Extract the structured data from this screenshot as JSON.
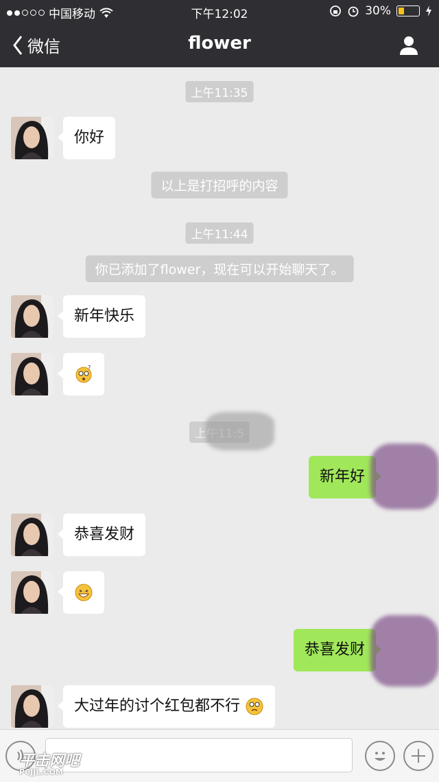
{
  "status_bar": {
    "carrier": "中国移动",
    "time": "下午12:02",
    "battery": "30%",
    "battery_level": 0.3
  },
  "nav": {
    "back_label": "微信",
    "title": "flower"
  },
  "messages": {
    "ts1": "上午11:35",
    "m1": "你好",
    "sys1": "以上是打招呼的内容",
    "ts2": "上午11:44",
    "sys2": "你已添加了flower，现在可以开始聊天了。",
    "m2": "新年快乐",
    "ts3": "上午11:5",
    "m4": "新年好",
    "m5": "恭喜发财",
    "m7": "恭喜发财",
    "m8": "大过年的讨个红包都不行"
  },
  "watermark": {
    "main": "平击网吧",
    "sub": "PCJJL.COM"
  },
  "colors": {
    "nav_bg": "#2e2e33",
    "chat_bg": "#ebebeb",
    "sent_bubble": "#a0e75a",
    "received_bubble": "#ffffff"
  }
}
